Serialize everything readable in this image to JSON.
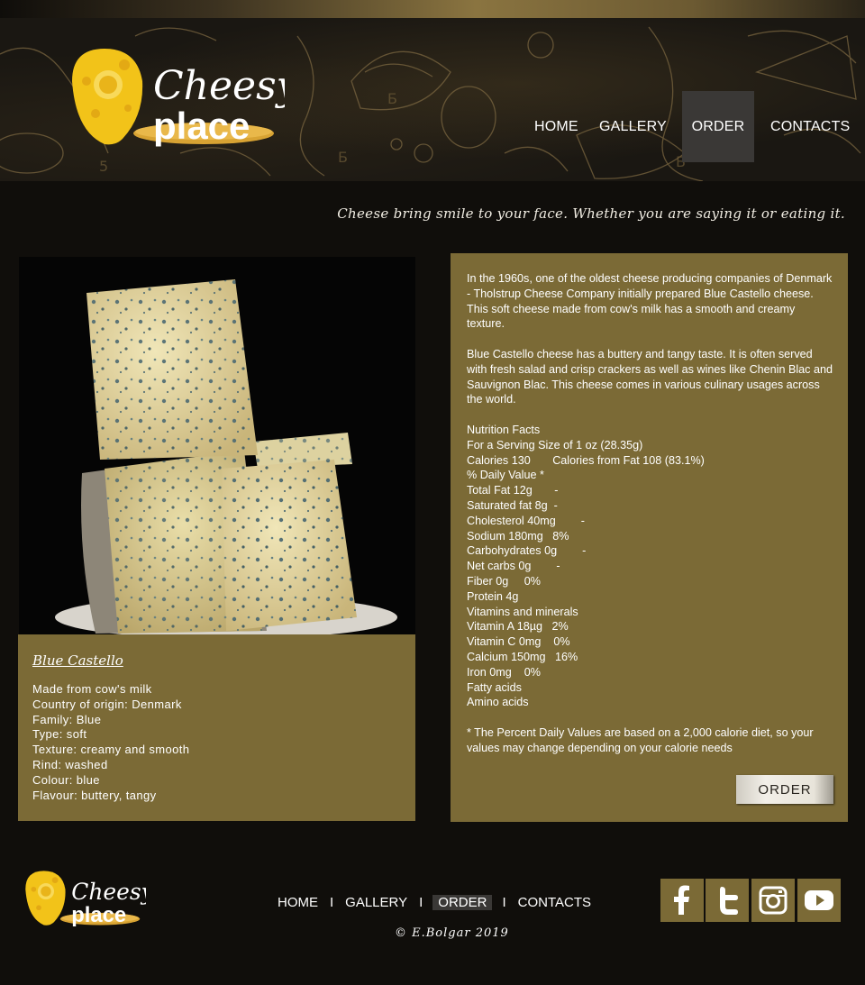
{
  "brand": {
    "line1": "Cheesy",
    "line2": "place"
  },
  "nav": [
    {
      "label": "HOME",
      "active": false
    },
    {
      "label": "GALLERY",
      "active": false
    },
    {
      "label": "ORDER",
      "active": true
    },
    {
      "label": "CONTACTS",
      "active": false
    }
  ],
  "tagline": "Cheese bring smile to your face. Whether you are saying it or eating it.",
  "cheese": {
    "name": "Blue Castello",
    "facts": [
      "Made from cow's milk",
      "Country of origin: Denmark",
      "Family: Blue",
      "Type: soft",
      "Texture: creamy and smooth",
      "Rind: washed",
      "Colour: blue",
      "Flavour: buttery, tangy"
    ]
  },
  "info": {
    "para1": "In the 1960s, one of the oldest cheese producing companies of Denmark  - Tholstrup Cheese Company initially prepared Blue Castello cheese. This soft cheese made from cow's milk has a smooth and creamy texture.",
    "para2": "Blue Castello cheese has a buttery and tangy taste. It is often served with fresh salad and crisp crackers as well as wines like Chenin Blac and Sauvignon Blac. This cheese comes in various culinary usages across the world.",
    "nutrition": [
      "Nutrition Facts",
      "For a Serving Size of 1 oz (28.35g)",
      "Calories 130       Calories from Fat 108 (83.1%)",
      "% Daily Value *",
      "Total Fat 12g       -",
      "Saturated fat 8g  -",
      "Cholesterol 40mg        -",
      "Sodium 180mg   8%",
      "Carbohydrates 0g        -",
      "Net carbs 0g        -",
      "Fiber 0g     0%",
      "Protein 4g",
      "Vitamins and minerals",
      "Vitamin A 18µg   2%",
      "Vitamin C 0mg    0%",
      "Calcium 150mg   16%",
      "Iron 0mg    0%",
      "Fatty acids",
      "Amino acids"
    ],
    "footnote": "* The Percent Daily Values are based on a 2,000 calorie diet, so your values may change depending on your calorie needs",
    "order_label": "ORDER"
  },
  "footer": {
    "nav": [
      {
        "label": "HOME",
        "active": false
      },
      {
        "label": "GALLERY",
        "active": false
      },
      {
        "label": "ORDER",
        "active": true
      },
      {
        "label": "CONTACTS",
        "active": false
      }
    ],
    "separator": "I",
    "copyright": "© E.Bolgar 2019",
    "social": [
      "facebook-icon",
      "twitter-icon",
      "instagram-icon",
      "youtube-icon"
    ]
  },
  "colors": {
    "panel": "#7b6a36",
    "background": "#100e0b",
    "active_nav": "#3a3836",
    "logo_yellow": "#f2c319"
  }
}
